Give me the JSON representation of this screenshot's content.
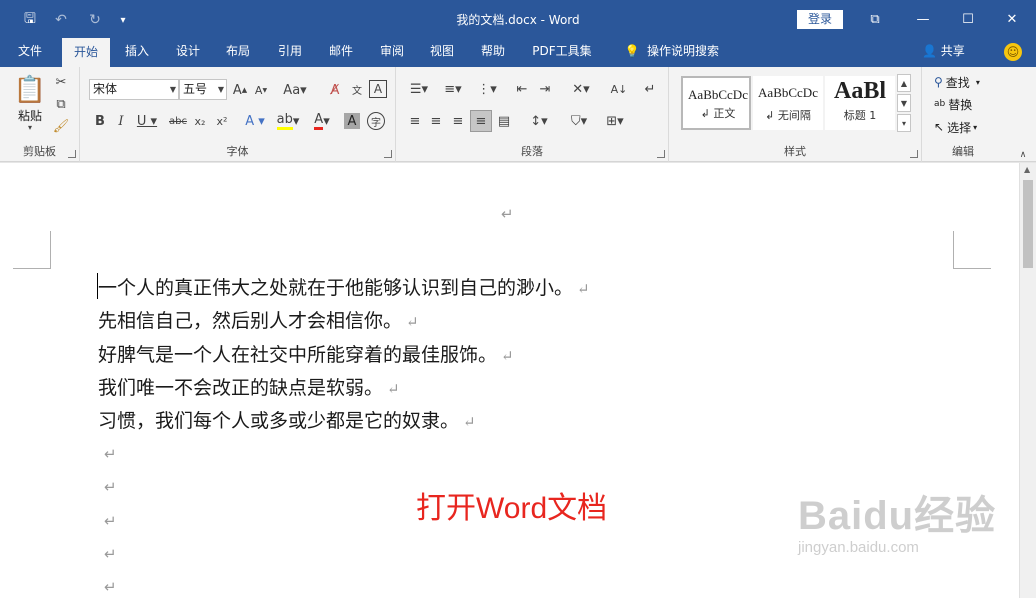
{
  "window": {
    "title": "我的文档.docx - Word",
    "login_label": "登录",
    "controls": {
      "restore": "⧉",
      "minimize": "—",
      "maximize": "☐",
      "close": "✕"
    }
  },
  "quick_access": {
    "save": "🖫",
    "undo": "↶",
    "redo": "↻",
    "customize": "▾"
  },
  "tabs": [
    "文件",
    "开始",
    "插入",
    "设计",
    "布局",
    "引用",
    "邮件",
    "审阅",
    "视图",
    "帮助",
    "PDF工具集",
    "操作说明搜索"
  ],
  "active_tab": "开始",
  "share_label": "共享",
  "ribbon": {
    "clipboard": {
      "label": "剪贴板",
      "paste": "粘贴"
    },
    "font": {
      "label": "字体",
      "name": "宋体",
      "size": "五号"
    },
    "paragraph": {
      "label": "段落"
    },
    "styles": {
      "label": "样式",
      "items": [
        {
          "sample": "AaBbCcDc",
          "name": "↲ 正文"
        },
        {
          "sample": "AaBbCcDc",
          "name": "↲ 无间隔"
        },
        {
          "sample": "AaBl",
          "name": "标题 1"
        }
      ]
    },
    "editing": {
      "label": "编辑",
      "find": "查找",
      "replace": "替换",
      "select": "选择"
    }
  },
  "document": {
    "paragraph_mark": "↵",
    "lines": [
      "一个人的真正伟大之处就在于他能够认识到自己的渺小。",
      "先相信自己，然后别人才会相信你。",
      "好脾气是一个人在社交中所能穿着的最佳服饰。",
      "我们唯一不会改正的缺点是软弱。",
      "习惯，我们每个人或多或少都是它的奴隶。"
    ],
    "overlay_caption": "打开Word文档",
    "watermark": {
      "main": "Baidu经验",
      "sub": "jingyan.baidu.com"
    }
  },
  "colors": {
    "brand": "#2b579a",
    "overlay": "#e8261f"
  }
}
